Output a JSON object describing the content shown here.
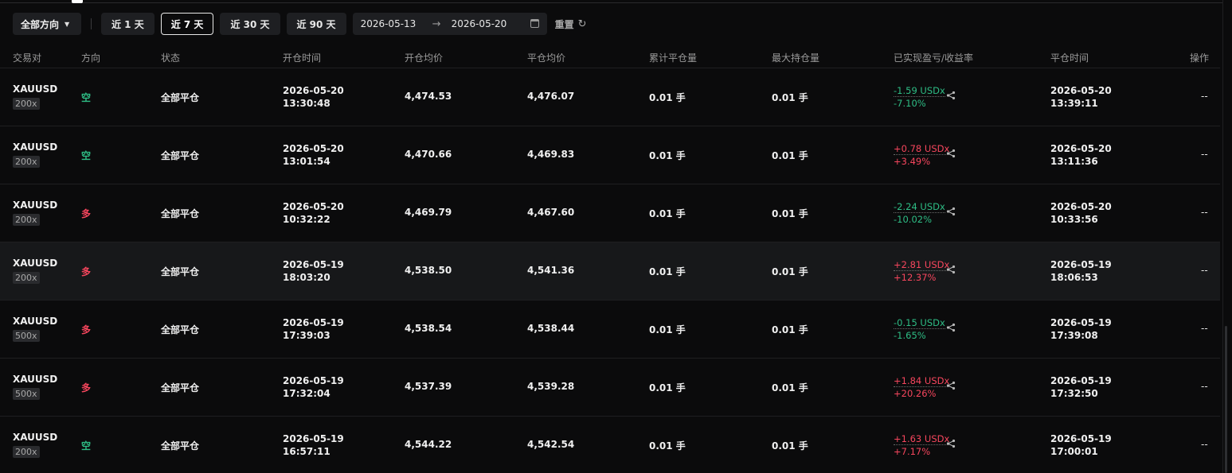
{
  "filters": {
    "direction_label": "全部方向",
    "ranges": [
      "近 1 天",
      "近 7 天",
      "近 30 天",
      "近 90 天"
    ],
    "active_range_index": 1,
    "date_start": "2026-05-13",
    "date_end": "2026-05-20",
    "reset_label": "重置"
  },
  "table": {
    "headers": {
      "symbol": "交易对",
      "direction": "方向",
      "status": "状态",
      "open_time": "开仓时间",
      "open_price": "开仓均价",
      "close_price": "平仓均价",
      "closed_qty": "累计平仓量",
      "max_qty": "最大持仓量",
      "pnl": "已实现盈亏/收益率",
      "close_time": "平仓时间",
      "action": "操作"
    },
    "rows": [
      {
        "symbol": "XAUUSD",
        "leverage": "200x",
        "direction": "空",
        "status": "全部平仓",
        "open_date": "2026-05-20",
        "open_clock": "13:30:48",
        "open_price": "4,474.53",
        "close_price": "4,476.07",
        "closed_qty": "0.01 手",
        "max_qty": "0.01 手",
        "pnl": "-1.59 USDx",
        "roi": "-7.10%",
        "close_date": "2026-05-20",
        "close_clock": "13:39:11",
        "action": "--"
      },
      {
        "symbol": "XAUUSD",
        "leverage": "200x",
        "direction": "空",
        "status": "全部平仓",
        "open_date": "2026-05-20",
        "open_clock": "13:01:54",
        "open_price": "4,470.66",
        "close_price": "4,469.83",
        "closed_qty": "0.01 手",
        "max_qty": "0.01 手",
        "pnl": "+0.78 USDx",
        "roi": "+3.49%",
        "close_date": "2026-05-20",
        "close_clock": "13:11:36",
        "action": "--"
      },
      {
        "symbol": "XAUUSD",
        "leverage": "200x",
        "direction": "多",
        "status": "全部平仓",
        "open_date": "2026-05-20",
        "open_clock": "10:32:22",
        "open_price": "4,469.79",
        "close_price": "4,467.60",
        "closed_qty": "0.01 手",
        "max_qty": "0.01 手",
        "pnl": "-2.24 USDx",
        "roi": "-10.02%",
        "close_date": "2026-05-20",
        "close_clock": "10:33:56",
        "action": "--"
      },
      {
        "symbol": "XAUUSD",
        "leverage": "200x",
        "direction": "多",
        "status": "全部平仓",
        "open_date": "2026-05-19",
        "open_clock": "18:03:20",
        "open_price": "4,538.50",
        "close_price": "4,541.36",
        "closed_qty": "0.01 手",
        "max_qty": "0.01 手",
        "pnl": "+2.81 USDx",
        "roi": "+12.37%",
        "close_date": "2026-05-19",
        "close_clock": "18:06:53",
        "action": "--"
      },
      {
        "symbol": "XAUUSD",
        "leverage": "500x",
        "direction": "多",
        "status": "全部平仓",
        "open_date": "2026-05-19",
        "open_clock": "17:39:03",
        "open_price": "4,538.54",
        "close_price": "4,538.44",
        "closed_qty": "0.01 手",
        "max_qty": "0.01 手",
        "pnl": "-0.15 USDx",
        "roi": "-1.65%",
        "close_date": "2026-05-19",
        "close_clock": "17:39:08",
        "action": "--"
      },
      {
        "symbol": "XAUUSD",
        "leverage": "500x",
        "direction": "多",
        "status": "全部平仓",
        "open_date": "2026-05-19",
        "open_clock": "17:32:04",
        "open_price": "4,537.39",
        "close_price": "4,539.28",
        "closed_qty": "0.01 手",
        "max_qty": "0.01 手",
        "pnl": "+1.84 USDx",
        "roi": "+20.26%",
        "close_date": "2026-05-19",
        "close_clock": "17:32:50",
        "action": "--"
      },
      {
        "symbol": "XAUUSD",
        "leverage": "200x",
        "direction": "空",
        "status": "全部平仓",
        "open_date": "2026-05-19",
        "open_clock": "16:57:11",
        "open_price": "4,544.22",
        "close_price": "4,542.54",
        "closed_qty": "0.01 手",
        "max_qty": "0.01 手",
        "pnl": "+1.63 USDx",
        "roi": "+7.17%",
        "close_date": "2026-05-19",
        "close_clock": "17:00:01",
        "action": "--"
      }
    ]
  },
  "colors": {
    "profit": "#f6465d",
    "loss": "#2ebd85",
    "long": "#f6465d",
    "short": "#2ebd85",
    "background": "#0b0b0c"
  },
  "icons": {
    "direction_caret": "caret-down-icon",
    "date_arrow": "arrow-right-icon",
    "calendar": "calendar-icon",
    "reset": "refresh-icon",
    "share": "share-icon"
  }
}
